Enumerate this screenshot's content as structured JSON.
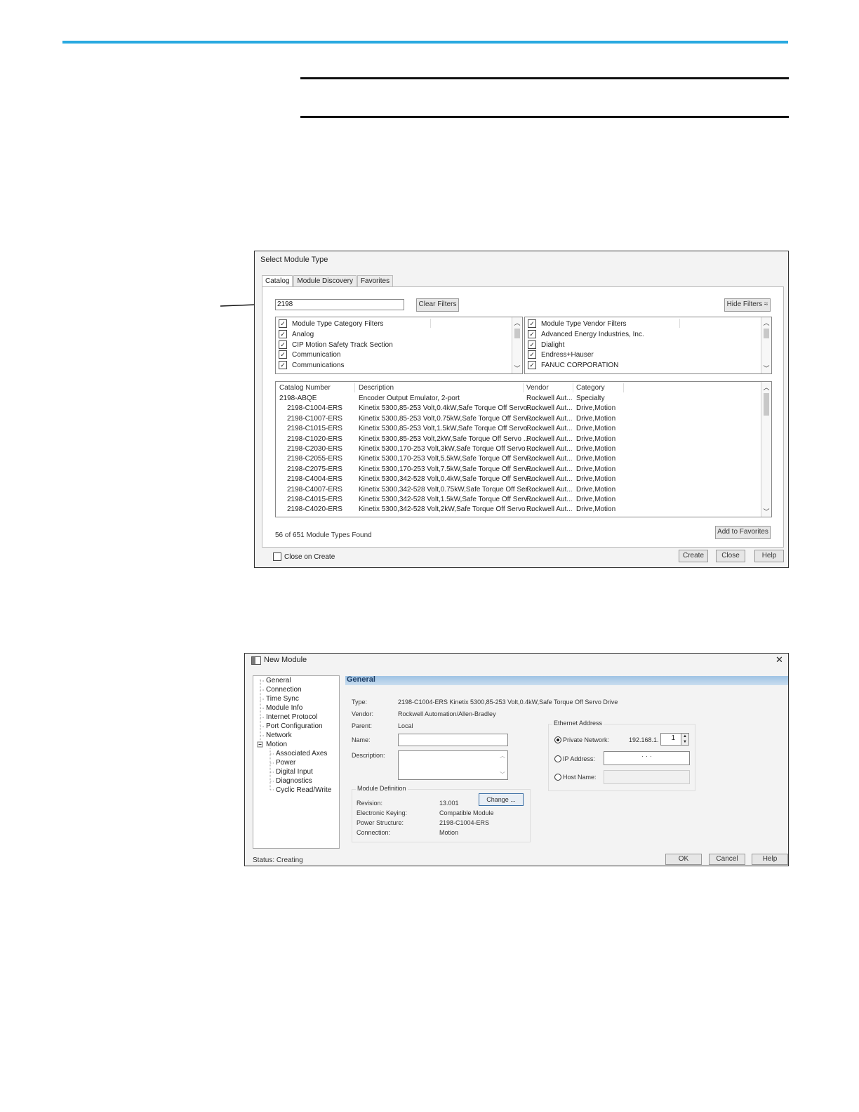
{
  "catalog_dialog": {
    "title": "Select Module Type",
    "tabs": [
      "Catalog",
      "Module Discovery",
      "Favorites"
    ],
    "search_value": "2198",
    "clear_filters": "Clear Filters",
    "hide_filters": "Hide Filters ≈",
    "category_filters": {
      "header": "Module Type Category Filters",
      "items": [
        "Analog",
        "CIP Motion Safety Track Section",
        "Communication",
        "Communications"
      ]
    },
    "vendor_filters": {
      "header": "Module Type Vendor Filters",
      "items": [
        "Advanced Energy Industries, Inc.",
        "Dialight",
        "Endress+Hauser",
        "FANUC CORPORATION"
      ]
    },
    "columns": [
      "Catalog Number",
      "Description",
      "Vendor",
      "Category"
    ],
    "rows": [
      [
        "2198-ABQE",
        "Encoder Output Emulator, 2-port",
        "Rockwell Aut...",
        "Specialty"
      ],
      [
        "2198-C1004-ERS",
        "Kinetix 5300,85-253 Volt,0.4kW,Safe Torque Off Servo...",
        "Rockwell Aut...",
        "Drive,Motion"
      ],
      [
        "2198-C1007-ERS",
        "Kinetix 5300,85-253 Volt,0.75kW,Safe Torque Off Serv...",
        "Rockwell Aut...",
        "Drive,Motion"
      ],
      [
        "2198-C1015-ERS",
        "Kinetix 5300,85-253 Volt,1.5kW,Safe Torque Off Servo...",
        "Rockwell Aut...",
        "Drive,Motion"
      ],
      [
        "2198-C1020-ERS",
        "Kinetix 5300,85-253 Volt,2kW,Safe Torque Off Servo ...",
        "Rockwell Aut...",
        "Drive,Motion"
      ],
      [
        "2198-C2030-ERS",
        "Kinetix 5300,170-253 Volt,3kW,Safe Torque Off Servo ...",
        "Rockwell Aut...",
        "Drive,Motion"
      ],
      [
        "2198-C2055-ERS",
        "Kinetix 5300,170-253 Volt,5.5kW,Safe Torque Off Serv...",
        "Rockwell Aut...",
        "Drive,Motion"
      ],
      [
        "2198-C2075-ERS",
        "Kinetix 5300,170-253 Volt,7.5kW,Safe Torque Off Serv...",
        "Rockwell Aut...",
        "Drive,Motion"
      ],
      [
        "2198-C4004-ERS",
        "Kinetix 5300,342-528 Volt,0.4kW,Safe Torque Off Serv...",
        "Rockwell Aut...",
        "Drive,Motion"
      ],
      [
        "2198-C4007-ERS",
        "Kinetix 5300,342-528 Volt,0.75kW,Safe Torque Off Ser...",
        "Rockwell Aut...",
        "Drive,Motion"
      ],
      [
        "2198-C4015-ERS",
        "Kinetix 5300,342-528 Volt,1.5kW,Safe Torque Off Serv...",
        "Rockwell Aut...",
        "Drive,Motion"
      ],
      [
        "2198-C4020-ERS",
        "Kinetix 5300,342-528 Volt,2kW,Safe Torque Off Servo ...",
        "Rockwell Aut...",
        "Drive,Motion"
      ]
    ],
    "found_text": "56 of 651 Module Types Found",
    "add_favorites": "Add to Favorites",
    "close_on_create": "Close on Create",
    "create": "Create",
    "close": "Close",
    "help": "Help"
  },
  "new_module_dialog": {
    "title": "New Module",
    "close_glyph": "✕",
    "tree": [
      "General",
      "Connection",
      "Time Sync",
      "Module Info",
      "Internet Protocol",
      "Port Configuration",
      "Network",
      "Motion",
      "Associated Axes",
      "Power",
      "Digital Input",
      "Diagnostics",
      "Cyclic Read/Write"
    ],
    "section": "General",
    "type_label": "Type:",
    "type_value": "2198-C1004-ERS Kinetix 5300,85-253 Volt,0.4kW,Safe Torque Off Servo Drive",
    "vendor_label": "Vendor:",
    "vendor_value": "Rockwell Automation/Allen-Bradley",
    "parent_label": "Parent:",
    "parent_value": "Local",
    "name_label": "Name:",
    "description_label": "Description:",
    "module_definition": {
      "title": "Module Definition",
      "revision_label": "Revision:",
      "revision_value": "13.001",
      "change": "Change ...",
      "keying_label": "Electronic Keying:",
      "keying_value": "Compatible Module",
      "power_label": "Power Structure:",
      "power_value": "2198-C1004-ERS",
      "connection_label": "Connection:",
      "connection_value": "Motion"
    },
    "ethernet": {
      "title": "Ethernet Address",
      "private_label": "Private Network:",
      "private_prefix": "192.168.1.",
      "private_last": "1",
      "ip_label": "IP Address:",
      "ip_dots": "·        ·        ·",
      "host_label": "Host Name:"
    },
    "status": "Status:  Creating",
    "ok": "OK",
    "cancel": "Cancel",
    "help": "Help"
  }
}
